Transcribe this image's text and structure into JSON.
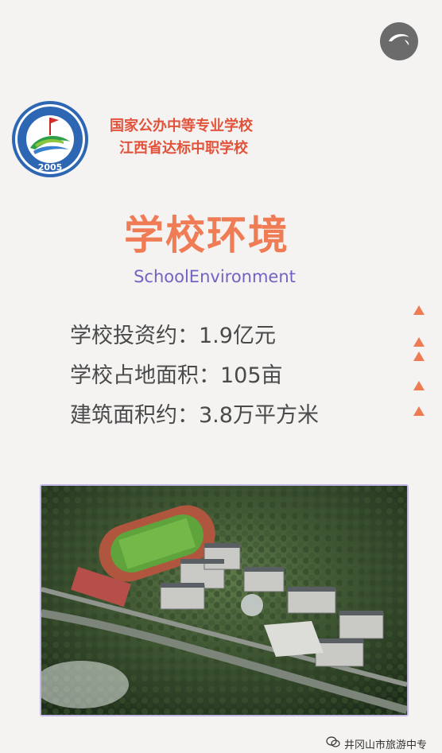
{
  "header": {
    "music_icon": "music-disc-icon",
    "logo_year": "2005",
    "logo_ring_text": "井冈山市旅游中等专业学校",
    "tag_line_1": "国家公办中等专业学校",
    "tag_line_2": "江西省达标中职学校"
  },
  "section": {
    "title_zh": "学校环境",
    "title_en": "SchoolEnvironment"
  },
  "facts": [
    "学校投资约：1.9亿元",
    "学校占地面积：105亩",
    "建筑面积约：3.8万平方米"
  ],
  "decor": {
    "triangle_color": "#ef7b53",
    "triangle_count": 5
  },
  "photo": {
    "subject": "campus aerial rendering"
  },
  "footer": {
    "watermark_icon": "wechat-icon",
    "watermark_text": "井冈山市旅游中专"
  },
  "colors": {
    "tag_red": "#e2533b",
    "title_orange": "#f07c56",
    "subtitle_purple": "#7660c2",
    "body_text": "#4a4a4a"
  }
}
